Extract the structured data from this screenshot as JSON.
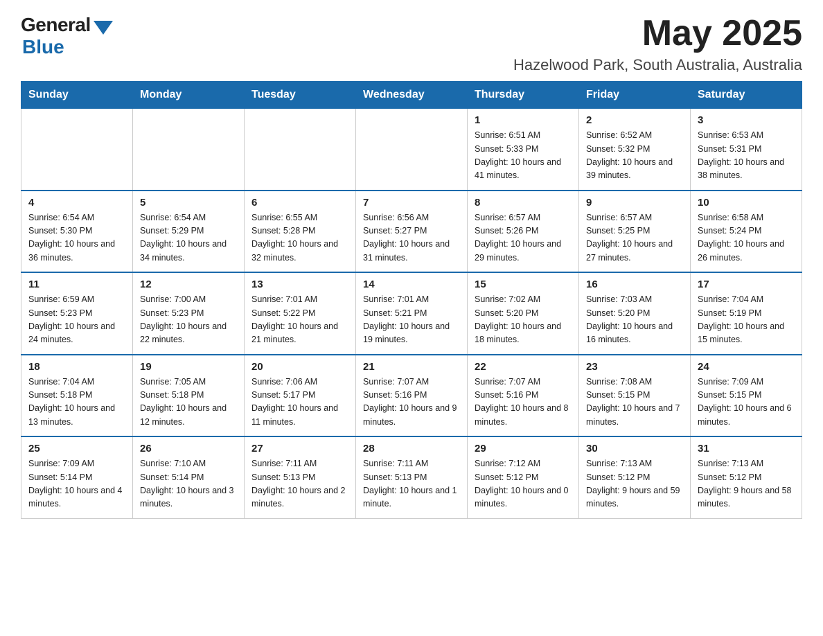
{
  "logo": {
    "general": "General",
    "blue": "Blue"
  },
  "header": {
    "month_year": "May 2025",
    "location": "Hazelwood Park, South Australia, Australia"
  },
  "days_of_week": [
    "Sunday",
    "Monday",
    "Tuesday",
    "Wednesday",
    "Thursday",
    "Friday",
    "Saturday"
  ],
  "weeks": [
    [
      {
        "day": "",
        "info": ""
      },
      {
        "day": "",
        "info": ""
      },
      {
        "day": "",
        "info": ""
      },
      {
        "day": "",
        "info": ""
      },
      {
        "day": "1",
        "info": "Sunrise: 6:51 AM\nSunset: 5:33 PM\nDaylight: 10 hours and 41 minutes."
      },
      {
        "day": "2",
        "info": "Sunrise: 6:52 AM\nSunset: 5:32 PM\nDaylight: 10 hours and 39 minutes."
      },
      {
        "day": "3",
        "info": "Sunrise: 6:53 AM\nSunset: 5:31 PM\nDaylight: 10 hours and 38 minutes."
      }
    ],
    [
      {
        "day": "4",
        "info": "Sunrise: 6:54 AM\nSunset: 5:30 PM\nDaylight: 10 hours and 36 minutes."
      },
      {
        "day": "5",
        "info": "Sunrise: 6:54 AM\nSunset: 5:29 PM\nDaylight: 10 hours and 34 minutes."
      },
      {
        "day": "6",
        "info": "Sunrise: 6:55 AM\nSunset: 5:28 PM\nDaylight: 10 hours and 32 minutes."
      },
      {
        "day": "7",
        "info": "Sunrise: 6:56 AM\nSunset: 5:27 PM\nDaylight: 10 hours and 31 minutes."
      },
      {
        "day": "8",
        "info": "Sunrise: 6:57 AM\nSunset: 5:26 PM\nDaylight: 10 hours and 29 minutes."
      },
      {
        "day": "9",
        "info": "Sunrise: 6:57 AM\nSunset: 5:25 PM\nDaylight: 10 hours and 27 minutes."
      },
      {
        "day": "10",
        "info": "Sunrise: 6:58 AM\nSunset: 5:24 PM\nDaylight: 10 hours and 26 minutes."
      }
    ],
    [
      {
        "day": "11",
        "info": "Sunrise: 6:59 AM\nSunset: 5:23 PM\nDaylight: 10 hours and 24 minutes."
      },
      {
        "day": "12",
        "info": "Sunrise: 7:00 AM\nSunset: 5:23 PM\nDaylight: 10 hours and 22 minutes."
      },
      {
        "day": "13",
        "info": "Sunrise: 7:01 AM\nSunset: 5:22 PM\nDaylight: 10 hours and 21 minutes."
      },
      {
        "day": "14",
        "info": "Sunrise: 7:01 AM\nSunset: 5:21 PM\nDaylight: 10 hours and 19 minutes."
      },
      {
        "day": "15",
        "info": "Sunrise: 7:02 AM\nSunset: 5:20 PM\nDaylight: 10 hours and 18 minutes."
      },
      {
        "day": "16",
        "info": "Sunrise: 7:03 AM\nSunset: 5:20 PM\nDaylight: 10 hours and 16 minutes."
      },
      {
        "day": "17",
        "info": "Sunrise: 7:04 AM\nSunset: 5:19 PM\nDaylight: 10 hours and 15 minutes."
      }
    ],
    [
      {
        "day": "18",
        "info": "Sunrise: 7:04 AM\nSunset: 5:18 PM\nDaylight: 10 hours and 13 minutes."
      },
      {
        "day": "19",
        "info": "Sunrise: 7:05 AM\nSunset: 5:18 PM\nDaylight: 10 hours and 12 minutes."
      },
      {
        "day": "20",
        "info": "Sunrise: 7:06 AM\nSunset: 5:17 PM\nDaylight: 10 hours and 11 minutes."
      },
      {
        "day": "21",
        "info": "Sunrise: 7:07 AM\nSunset: 5:16 PM\nDaylight: 10 hours and 9 minutes."
      },
      {
        "day": "22",
        "info": "Sunrise: 7:07 AM\nSunset: 5:16 PM\nDaylight: 10 hours and 8 minutes."
      },
      {
        "day": "23",
        "info": "Sunrise: 7:08 AM\nSunset: 5:15 PM\nDaylight: 10 hours and 7 minutes."
      },
      {
        "day": "24",
        "info": "Sunrise: 7:09 AM\nSunset: 5:15 PM\nDaylight: 10 hours and 6 minutes."
      }
    ],
    [
      {
        "day": "25",
        "info": "Sunrise: 7:09 AM\nSunset: 5:14 PM\nDaylight: 10 hours and 4 minutes."
      },
      {
        "day": "26",
        "info": "Sunrise: 7:10 AM\nSunset: 5:14 PM\nDaylight: 10 hours and 3 minutes."
      },
      {
        "day": "27",
        "info": "Sunrise: 7:11 AM\nSunset: 5:13 PM\nDaylight: 10 hours and 2 minutes."
      },
      {
        "day": "28",
        "info": "Sunrise: 7:11 AM\nSunset: 5:13 PM\nDaylight: 10 hours and 1 minute."
      },
      {
        "day": "29",
        "info": "Sunrise: 7:12 AM\nSunset: 5:12 PM\nDaylight: 10 hours and 0 minutes."
      },
      {
        "day": "30",
        "info": "Sunrise: 7:13 AM\nSunset: 5:12 PM\nDaylight: 9 hours and 59 minutes."
      },
      {
        "day": "31",
        "info": "Sunrise: 7:13 AM\nSunset: 5:12 PM\nDaylight: 9 hours and 58 minutes."
      }
    ]
  ]
}
